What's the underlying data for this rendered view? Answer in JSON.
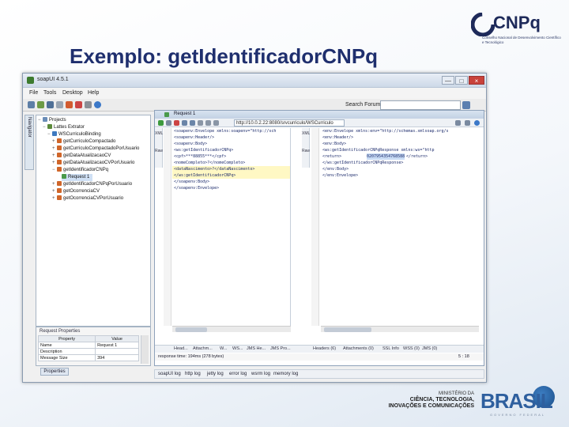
{
  "slide": {
    "title": "Exemplo: getIdentificadorCNPq"
  },
  "logo": {
    "name": "CNPq",
    "subtitle": "Conselho Nacional de Desenvolvimento Científico e Tecnológico"
  },
  "window": {
    "title": "soapUI 4.5.1",
    "minimize": "—",
    "maximize": "□",
    "close": "×"
  },
  "menu": [
    "File",
    "Tools",
    "Desktop",
    "Help"
  ],
  "toolbar": {
    "search_label": "Search Forum",
    "search_value": ""
  },
  "navigator": {
    "label": "Navigator"
  },
  "tree": {
    "root": "Projects",
    "project": "Lattes Extrator",
    "service": "WSCurriculoBinding",
    "operations": [
      "getCurriculoCompactado",
      "getCurriculoCompactadoPorUsuario",
      "getDataAtualizacaoCV",
      "getDataAtualizacaoCVPorUsuario",
      "getIdentificadorCNPq",
      "Request 1",
      "getIdentificadorCNPqPorUsuario",
      "getOcorrenciaCV",
      "getOcorrenciaCVPorUsuario"
    ]
  },
  "properties": {
    "title": "Request Properties",
    "headers": [
      "Property",
      "Value"
    ],
    "rows": [
      {
        "name": "Name",
        "value": "Request 1"
      },
      {
        "name": "Description",
        "value": ""
      },
      {
        "name": "Message Size",
        "value": "394"
      }
    ],
    "button": "Properties"
  },
  "request": {
    "title": "Request 1",
    "url": "http://10.0.2.22:8080/srvcurriculo/WSCurriculo",
    "side_tabs": [
      "XML",
      "Raw"
    ],
    "left_code": [
      "<soapenv:Envelope xmlns:soapenv=\"http://sch",
      "  <soapenv:Header/>",
      "  <soapenv:Body>",
      "    <ws:getIdentificadorCNPq>",
      "      <cpf>***88855***</cpf>",
      "      <nomeCompleto>?</nomeCompleto>",
      "      <dataNascimento>?</dataNascimento>",
      "    </ws:getIdentificadorCNPq>",
      "  </soapenv:Body>",
      "</soapenv:Envelope>"
    ],
    "right_code": [
      "<env:Envelope xmlns:env=\"http://schemas.xmlsoap.org/s",
      "  <env:Header/>",
      "  <env:Body>",
      "    <ws:getIdentificadorCNPqResponse xmlns:ws=\"http",
      "      <return>",
      "0207954354768588",
      "</return>",
      "    </ws:getIdentificadorCNPqResponse>",
      "  </env:Body>",
      "</env:Envelope>"
    ],
    "left_tabs": [
      "Head...",
      "Attachm...",
      "W...",
      "WS...",
      "JMS He...",
      "JMS Pro..."
    ],
    "right_tabs": [
      "Headers (6)",
      "Attachments (0)",
      "SSL Info",
      "WSS (0)",
      "JMS (0)"
    ],
    "response_time": "response time: 194ms (278 bytes)",
    "cursor": "5 : 18"
  },
  "logs": [
    "soapUI log",
    "http log",
    "jetty log",
    "error log",
    "wsrm log",
    "memory log"
  ],
  "footer": {
    "ministry_line1": "MINISTÉRIO DA",
    "ministry_line2": "CIÊNCIA, TECNOLOGIA,",
    "ministry_line3": "INOVAÇÕES E COMUNICAÇÕES",
    "brasil": "BRASIL",
    "brasil_sub": "GOVERNO FEDERAL"
  }
}
